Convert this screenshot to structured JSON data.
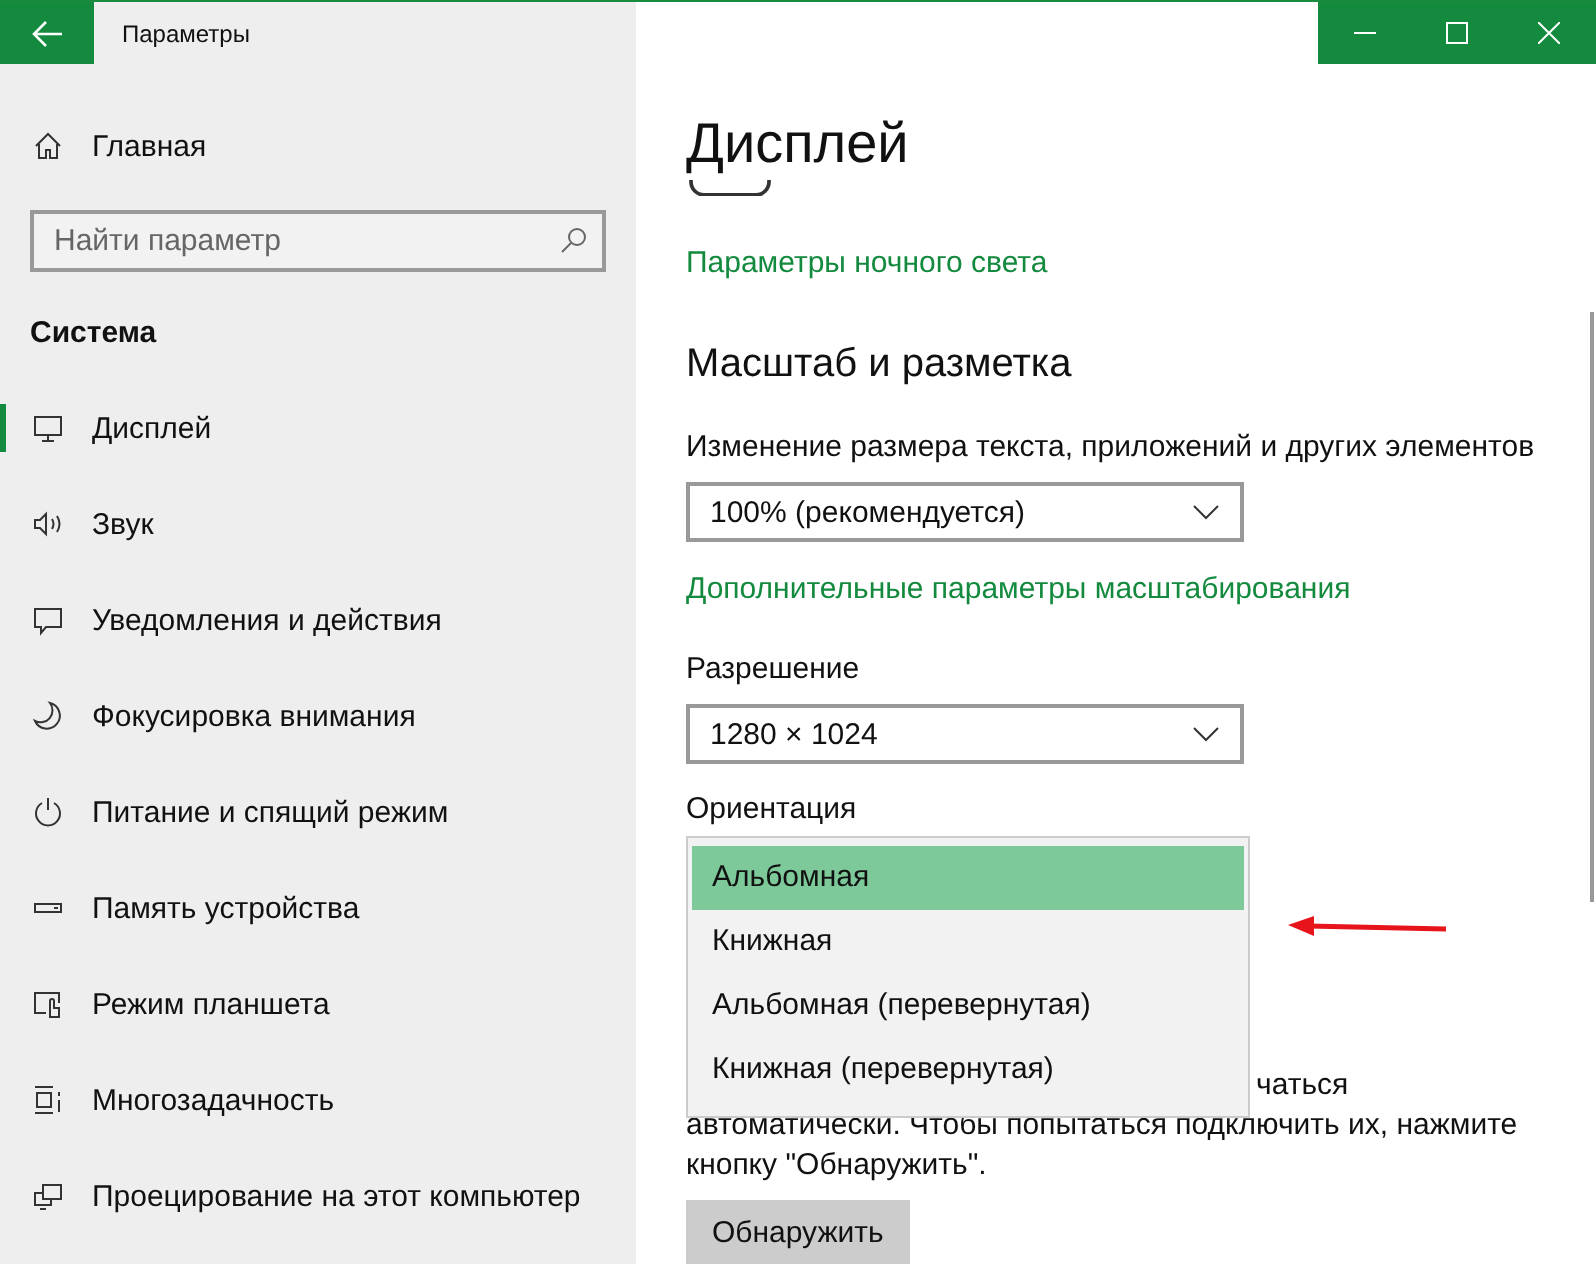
{
  "window": {
    "title": "Параметры"
  },
  "sidebar": {
    "home": "Главная",
    "search": {
      "placeholder": "Найти параметр"
    },
    "section": "Система",
    "items": [
      {
        "label": "Дисплей",
        "selected": true
      },
      {
        "label": "Звук",
        "selected": false
      },
      {
        "label": "Уведомления и действия",
        "selected": false
      },
      {
        "label": "Фокусировка внимания",
        "selected": false
      },
      {
        "label": "Питание и спящий режим",
        "selected": false
      },
      {
        "label": "Память устройства",
        "selected": false
      },
      {
        "label": "Режим планшета",
        "selected": false
      },
      {
        "label": "Многозадачность",
        "selected": false
      },
      {
        "label": "Проецирование на этот компьютер",
        "selected": false
      }
    ]
  },
  "content": {
    "heading": "Дисплей",
    "night_light_link": "Параметры ночного света",
    "scale_heading": "Масштаб и разметка",
    "scale_label": "Изменение размера текста, приложений и других элементов",
    "scale_value": "100% (рекомендуется)",
    "advanced_scaling_link": "Дополнительные параметры масштабирования",
    "resolution_label": "Разрешение",
    "resolution_value": "1280 × 1024",
    "orientation_label": "Ориентация",
    "orientation_options": [
      {
        "label": "Альбомная",
        "selected": true
      },
      {
        "label": "Книжная",
        "selected": false
      },
      {
        "label": "Альбомная (перевернутая)",
        "selected": false
      },
      {
        "label": "Книжная (перевернутая)",
        "selected": false
      }
    ],
    "detect_text_fragment": "чаться",
    "detect_text": "автоматически. Чтобы попытаться подключить их, нажмите кнопку \"Обнаружить\".",
    "detect_button": "Обнаружить"
  }
}
